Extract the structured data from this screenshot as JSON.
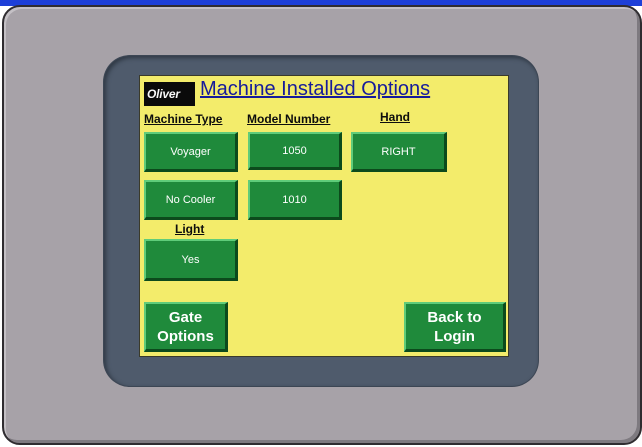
{
  "screen": {
    "logo_text": "Oliver",
    "title": "Machine Installed Options",
    "colors": {
      "screen_bg": "#f3ec6b",
      "title": "#161b9b",
      "button": "#1f8a3b",
      "bezel": "#4f5b6c",
      "housing": "#a7a2a8"
    }
  },
  "columns": {
    "machine_type": "Machine Type",
    "model_number": "Model Number",
    "hand": "Hand",
    "light": "Light"
  },
  "buttons": {
    "machine_type": "Voyager",
    "cooler": "No Cooler",
    "model_1": "1050",
    "model_2": "1010",
    "hand": "RIGHT",
    "light": "Yes",
    "gate_options": "Gate\nOptions",
    "back_to_login": "Back to\nLogin"
  }
}
